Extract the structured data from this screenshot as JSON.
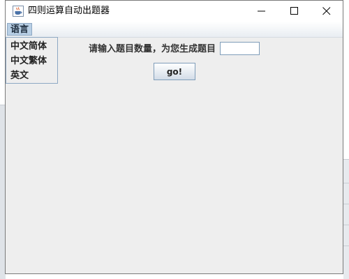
{
  "window": {
    "title": "四则运算自动出题器",
    "app_icon": "java-cup-icon",
    "controls": [
      "minimize-icon",
      "maximize-icon",
      "close-icon"
    ]
  },
  "menubar": {
    "menus": [
      {
        "label": "语言"
      }
    ]
  },
  "language_menu": {
    "items": [
      {
        "label": "中文简体"
      },
      {
        "label": "中文繁体"
      },
      {
        "label": "英文"
      }
    ]
  },
  "main": {
    "prompt_label": "请输入题目数量，为您生成题目",
    "count_input_value": "",
    "go_button_label": "go!"
  },
  "colors": {
    "window_bg": "#eeeeee",
    "menu_highlight": "#b8cfe5",
    "accent_border": "#8ea8c3"
  }
}
